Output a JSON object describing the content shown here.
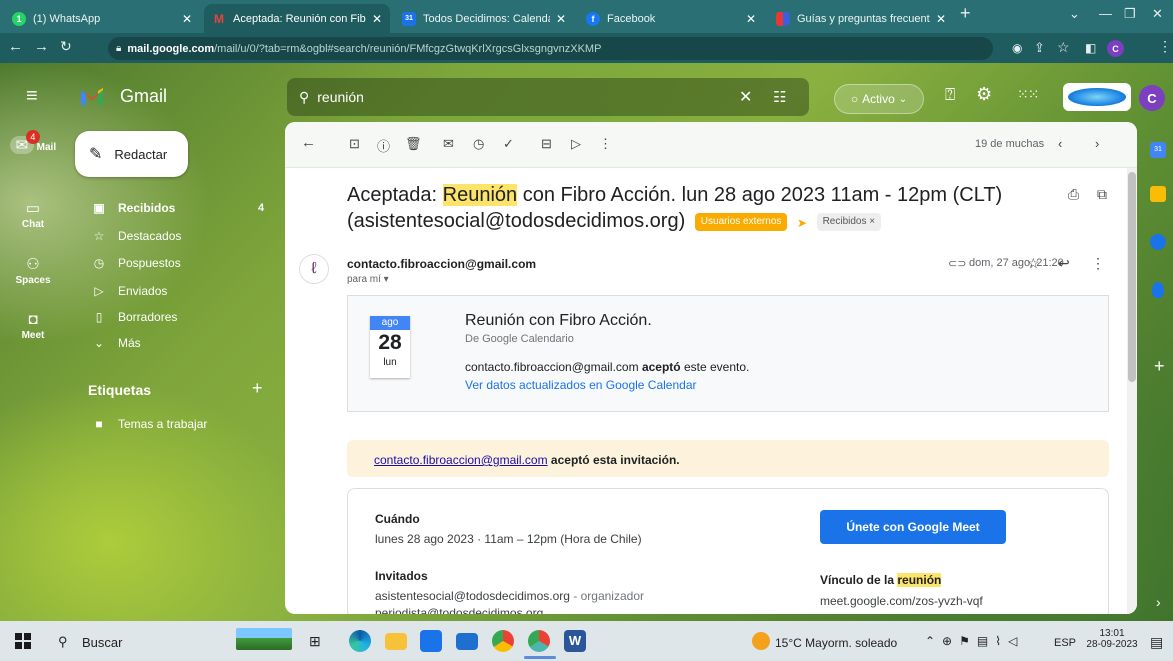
{
  "browser": {
    "tabs": [
      {
        "title": "(1) WhatsApp",
        "color": "#25d366",
        "icon": "whatsapp-icon",
        "glyph": "1"
      },
      {
        "title": "Aceptada: Reunión con Fibro",
        "color": "#ea4335",
        "icon": "gmail-icon",
        "glyph": "M"
      },
      {
        "title": "Todos Decidimos: Calendario",
        "color": "#1a73e8",
        "icon": "calendar-icon",
        "glyph": "31"
      },
      {
        "title": "Facebook",
        "color": "#1877f2",
        "icon": "facebook-icon",
        "glyph": "f"
      },
      {
        "title": "Guías y preguntas frecuentes",
        "color": "#3b5fd9",
        "icon": "guide-icon",
        "glyph": ""
      }
    ],
    "new_tab": "+",
    "url_host": "mail.google.com",
    "url_path": "/mail/u/0/?tab=rm&ogbl#search/reunión/FMfcgzGtwqKrlXrgcsGlxsgngvnzXKMP"
  },
  "gmail": {
    "app_name": "Gmail",
    "search_query": "reunión",
    "status": "Activo",
    "avatar_letter": "C",
    "mail_badge": "4",
    "rail": [
      {
        "label": "Mail",
        "icon": "mail-icon"
      },
      {
        "label": "Chat",
        "icon": "chat-icon"
      },
      {
        "label": "Spaces",
        "icon": "spaces-icon"
      },
      {
        "label": "Meet",
        "icon": "meet-icon"
      }
    ],
    "compose": "Redactar",
    "nav": [
      {
        "label": "Recibidos",
        "count": "4",
        "icon": "inbox-icon",
        "bold": true
      },
      {
        "label": "Destacados",
        "count": "",
        "icon": "star-icon"
      },
      {
        "label": "Pospuestos",
        "count": "",
        "icon": "clock-icon"
      },
      {
        "label": "Enviados",
        "count": "",
        "icon": "send-icon"
      },
      {
        "label": "Borradores",
        "count": "",
        "icon": "draft-icon"
      },
      {
        "label": "Más",
        "count": "",
        "icon": "expand-icon"
      }
    ],
    "labels_title": "Etiquetas",
    "labels": [
      {
        "label": "Temas a trabajar"
      }
    ],
    "pagination": "19 de muchas"
  },
  "email": {
    "subject_pre": "Aceptada: ",
    "subject_hl": "Reunión",
    "subject_post": " con Fibro Acción. lun 28 ago 2023 11am - 12pm (CLT)",
    "subject_line2": "(asistentesocial@todosdecidimos.org)",
    "chip_external": "Usuarios externos",
    "chip_inbox": "Recibidos",
    "sender": "contacto.fibroaccion@gmail.com",
    "to": "para mí",
    "date": "dom, 27 ago, 21:20",
    "card": {
      "month": "ago",
      "day": "28",
      "weekday": "lun",
      "title": "Reunión con Fibro Acción.",
      "from": "De Google Calendario",
      "accept_pre": "contacto.fibroaccion@gmail.com",
      "accept_bold": "aceptó",
      "accept_post": " este evento.",
      "link": "Ver datos actualizados en Google Calendar"
    },
    "banner_link": "contacto.fibroaccion@gmail.com",
    "banner_text": " aceptó esta invitación.",
    "when_label": "Cuándo",
    "when_value": "lunes 28 ago 2023 · 11am – 12pm (Hora de Chile)",
    "guests_label": "Invitados",
    "guest1": "asistentesocial@todosdecidimos.org",
    "guest1_role": " - organizador",
    "guest2": "periodista@todosdecidimos.org",
    "meet_button": "Únete con Google Meet",
    "link_label_pre": "Vínculo de la ",
    "link_label_hl": "reunión",
    "meet_url": "meet.google.com/zos-yvzh-vqf"
  },
  "taskbar": {
    "search": "Buscar",
    "weather": "15°C  Mayorm. soleado",
    "lang": "ESP",
    "time": "13:01",
    "date": "28-09-2023"
  }
}
